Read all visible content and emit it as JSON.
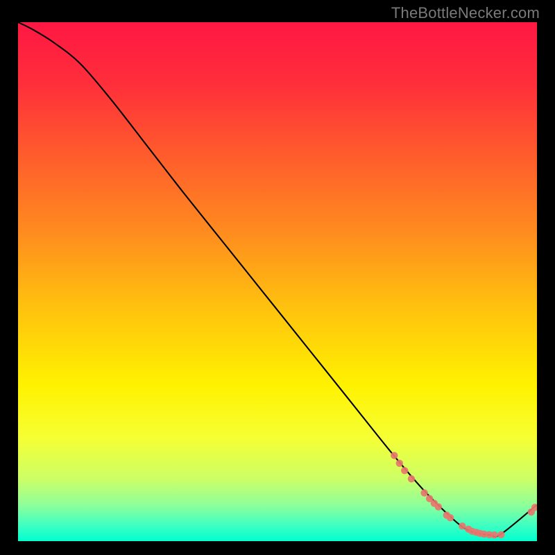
{
  "watermark": "TheBottleNecker.com",
  "chart_data": {
    "type": "line",
    "title": "",
    "xlabel": "",
    "ylabel": "",
    "xlim": [
      0,
      100
    ],
    "ylim": [
      0,
      100
    ],
    "grid": false,
    "legend": false,
    "background": {
      "type": "vertical-gradient",
      "stops": [
        {
          "pos": 0.0,
          "color": "#ff1744"
        },
        {
          "pos": 0.12,
          "color": "#ff2f3a"
        },
        {
          "pos": 0.25,
          "color": "#ff5a2d"
        },
        {
          "pos": 0.4,
          "color": "#ff8a1f"
        },
        {
          "pos": 0.55,
          "color": "#ffc20e"
        },
        {
          "pos": 0.7,
          "color": "#fff200"
        },
        {
          "pos": 0.8,
          "color": "#f6ff33"
        },
        {
          "pos": 0.88,
          "color": "#ccff66"
        },
        {
          "pos": 0.93,
          "color": "#8fff99"
        },
        {
          "pos": 0.97,
          "color": "#3effc2"
        },
        {
          "pos": 1.0,
          "color": "#00ffd0"
        }
      ]
    },
    "series": [
      {
        "name": "bottleneck-curve",
        "color": "#000000",
        "x": [
          0,
          3,
          7,
          12,
          18,
          25,
          32,
          40,
          48,
          56,
          64,
          72,
          78,
          83,
          86,
          88.5,
          91,
          93,
          100
        ],
        "y": [
          100,
          98.5,
          96,
          92,
          85,
          76,
          67,
          57,
          47,
          37,
          27,
          17,
          10,
          5,
          2.5,
          1.5,
          1.2,
          1.3,
          7
        ]
      }
    ],
    "points": {
      "name": "hotspots",
      "color": "#e8766e",
      "xy": [
        [
          72.5,
          16.5
        ],
        [
          73.5,
          15.0
        ],
        [
          74.5,
          13.6
        ],
        [
          75.8,
          12.0
        ],
        [
          78.3,
          9.3
        ],
        [
          79.3,
          8.2
        ],
        [
          80.2,
          7.3
        ],
        [
          81.0,
          6.6
        ],
        [
          82.6,
          5.0
        ],
        [
          83.3,
          4.5
        ],
        [
          85.6,
          2.9
        ],
        [
          86.8,
          2.3
        ],
        [
          87.5,
          1.9
        ],
        [
          88.3,
          1.7
        ],
        [
          89.0,
          1.5
        ],
        [
          89.8,
          1.35
        ],
        [
          90.8,
          1.25
        ],
        [
          91.8,
          1.2
        ],
        [
          93.1,
          1.25
        ],
        [
          98.9,
          5.6
        ],
        [
          99.6,
          6.5
        ]
      ]
    }
  }
}
